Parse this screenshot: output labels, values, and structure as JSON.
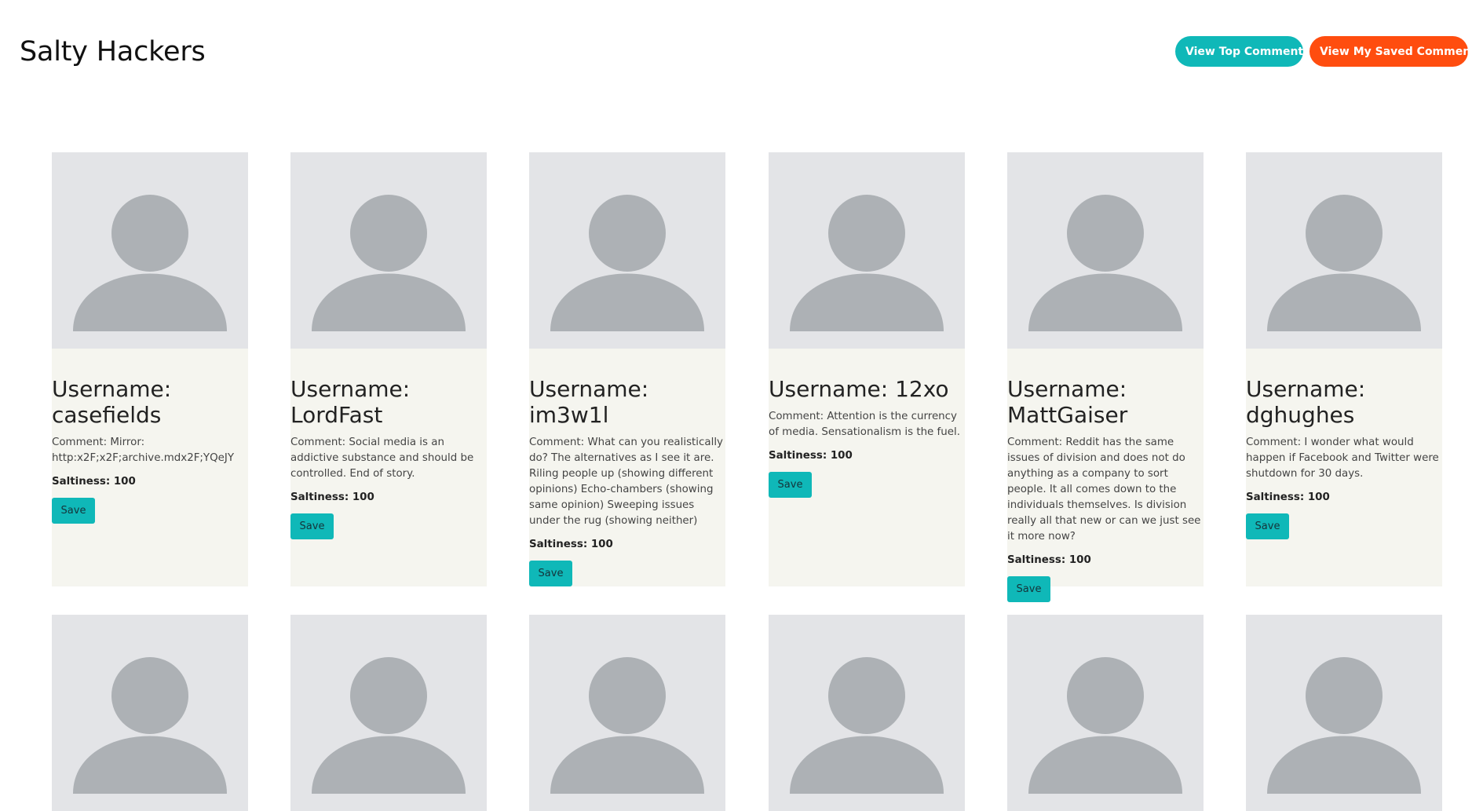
{
  "header": {
    "title": "Salty Hackers",
    "view_top_label": "View Top Comments",
    "view_saved_label": "View My Saved Comments"
  },
  "labels": {
    "comment_prefix": "Comment: ",
    "saltiness_prefix": "Saltiness: ",
    "save": "Save"
  },
  "comments": [
    {
      "username": "Username: casefields",
      "comment": "Comment: Mirror: http:x2F;x2F;archive.mdx2F;YQeJY",
      "saltiness": "Saltiness: 100",
      "save_label": "Save"
    },
    {
      "username": "Username: LordFast",
      "comment": "Comment: Social media is an addictive substance and should be controlled. End of story.",
      "saltiness": "Saltiness: 100",
      "save_label": "Save"
    },
    {
      "username": "Username: im3w1l",
      "comment": "Comment: What can you realistically do? The alternatives as I see it are. Riling people up (showing different opinions) Echo-chambers (showing same opinion) Sweeping issues under the rug (showing neither)",
      "saltiness": "Saltiness: 100",
      "save_label": "Save"
    },
    {
      "username": "Username: 12xo",
      "comment": "Comment: Attention is the currency of media. Sensationalism is the fuel.",
      "saltiness": "Saltiness: 100",
      "save_label": "Save"
    },
    {
      "username": "Username: MattGaiser",
      "comment": "Comment: Reddit has the same issues of division and does not do anything as a company to sort people. It all comes down to the individuals themselves. Is division really all that new or can we just see it more now?",
      "saltiness": "Saltiness: 100",
      "save_label": "Save"
    },
    {
      "username": "Username: dghughes",
      "comment": "Comment: I wonder what would happen if Facebook and Twitter were shutdown for 30 days.",
      "saltiness": "Saltiness: 100",
      "save_label": "Save"
    }
  ],
  "colors": {
    "accent_teal": "#0fb8b8",
    "accent_orange": "#ff4d0f",
    "card_bg": "#f5f5ef",
    "avatar_bg": "#e3e4e7",
    "avatar_fg": "#adb1b5"
  },
  "icons": {
    "avatar": "user-placeholder-icon"
  }
}
